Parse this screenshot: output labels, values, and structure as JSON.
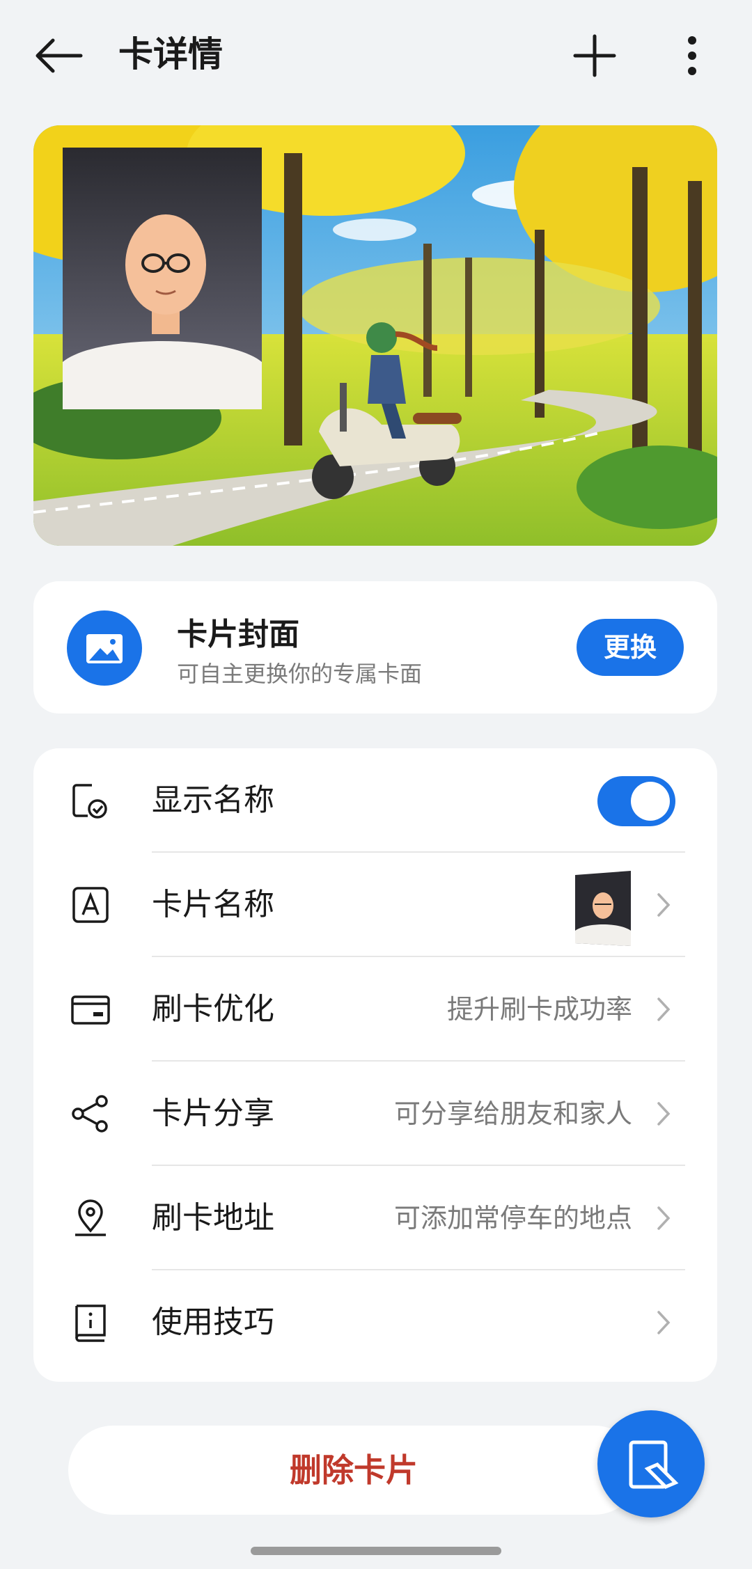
{
  "header": {
    "title": "卡详情"
  },
  "cover": {
    "title": "卡片封面",
    "subtitle": "可自主更换你的专属卡面",
    "change_label": "更换"
  },
  "settings": {
    "items": [
      {
        "label": "显示名称",
        "value": "",
        "toggle_on": true
      },
      {
        "label": "卡片名称",
        "value": ""
      },
      {
        "label": "刷卡优化",
        "value": "提升刷卡成功率"
      },
      {
        "label": "卡片分享",
        "value": "可分享给朋友和家人"
      },
      {
        "label": "刷卡地址",
        "value": "可添加常停车的地点"
      },
      {
        "label": "使用技巧",
        "value": ""
      }
    ]
  },
  "actions": {
    "delete_label": "删除卡片"
  },
  "icons": {
    "back": "back-arrow-icon",
    "add": "plus-icon",
    "more": "more-vertical-icon",
    "cover": "image-icon",
    "display_name": "card-check-icon",
    "card_name": "letter-a-icon",
    "optimize": "card-icon",
    "share": "share-icon",
    "address": "location-pin-icon",
    "tips": "book-info-icon",
    "fab": "edit-card-icon"
  },
  "colors": {
    "accent": "#1a73e8",
    "danger": "#c0392b",
    "background": "#f1f3f5"
  }
}
